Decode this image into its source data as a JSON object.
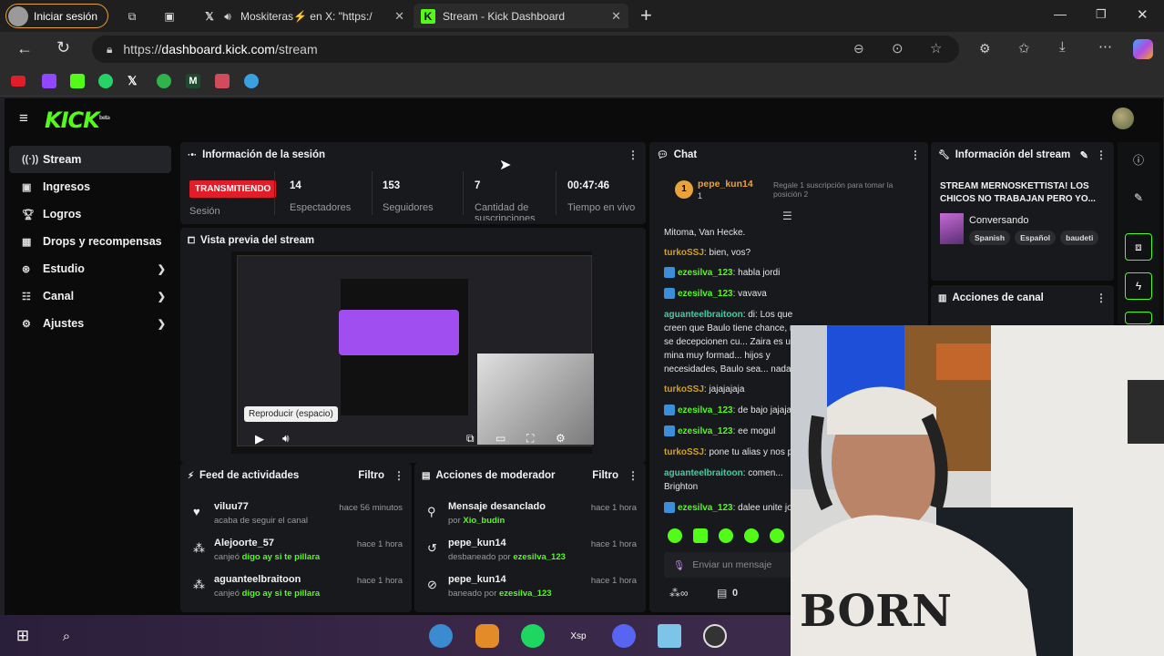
{
  "browser": {
    "signin_label": "Iniciar sesión",
    "tabs": [
      {
        "label": "Moskiteras⚡ en X: \"https:/",
        "icon": "x-icon"
      },
      {
        "label": "Stream - Kick Dashboard",
        "icon": "kick-icon"
      }
    ],
    "url_scheme": "https://",
    "url_host": "dashboard.kick.com",
    "url_path": "/stream"
  },
  "kick": {
    "logo": "KICK",
    "logo_sup": "beta",
    "sidebar": [
      {
        "label": "Stream",
        "icon": "radio-icon"
      },
      {
        "label": "Ingresos",
        "icon": "wallet-icon"
      },
      {
        "label": "Logros",
        "icon": "trophy-icon"
      },
      {
        "label": "Drops y recompensas",
        "icon": "gift-icon"
      },
      {
        "label": "Estudio",
        "icon": "studio-icon"
      },
      {
        "label": "Canal",
        "icon": "channel-icon"
      },
      {
        "label": "Ajustes",
        "icon": "gear-icon"
      }
    ],
    "session": {
      "title": "Información de la sesión",
      "live_badge": "TRANSMITIENDO",
      "live_label": "Sesión",
      "stats": [
        {
          "value": "14",
          "label": "Espectadores"
        },
        {
          "value": "153",
          "label": "Seguidores"
        },
        {
          "value": "7",
          "label": "Cantidad de suscripciones"
        },
        {
          "value": "00:47:46",
          "label": "Tiempo en vivo"
        }
      ]
    },
    "preview": {
      "title": "Vista previa del stream",
      "tooltip": "Reproducir (espacio)"
    },
    "feed": {
      "title": "Feed de actividades",
      "filter": "Filtro",
      "items": [
        {
          "user": "viluu77",
          "action": "acaba de seguir el canal",
          "highlight": "",
          "time": "hace 56 minutos",
          "icon": "heart-icon"
        },
        {
          "user": "Alejoorte_57",
          "action": "canjeó ",
          "highlight": "digo ay si te pillara",
          "time": "hace 1 hora",
          "icon": "points-icon"
        },
        {
          "user": "aguanteelbraitoon",
          "action": "canjeó ",
          "highlight": "digo ay si te pillara",
          "time": "hace 1 hora",
          "icon": "points-icon"
        }
      ]
    },
    "mod": {
      "title": "Acciones de moderador",
      "filter": "Filtro",
      "items": [
        {
          "user": "Mensaje desanclado",
          "action": "por ",
          "highlight": "Xio_budin",
          "time": "hace 1 hora",
          "icon": "unpin-icon"
        },
        {
          "user": "pepe_kun14",
          "action": "desbaneado por ",
          "highlight": "ezesilva_123",
          "time": "hace 1 hora",
          "icon": "unban-icon"
        },
        {
          "user": "pepe_kun14",
          "action": "baneado por ",
          "highlight": "ezesilva_123",
          "time": "hace 1 hora",
          "icon": "ban-icon"
        }
      ]
    },
    "chat": {
      "title": "Chat",
      "pinned_user": "pepe_kun14",
      "pinned_count": "1",
      "gift_text": "Regale 1 suscripción para tomar la posición 2",
      "messages": [
        {
          "user": "",
          "text": "Mitoma, Van Hecke.",
          "color": "#e6e6e6"
        },
        {
          "user": "turkoSSJ",
          "text": ": bien, vos?",
          "color": "#d4a017"
        },
        {
          "user": "ezesilva_123",
          "text": ": habla jordi",
          "color": "#53fc18"
        },
        {
          "user": "ezesilva_123",
          "text": ": vavava",
          "color": "#53fc18"
        },
        {
          "user": "aguanteelbraitoon",
          "text": ": di: Los que creen que Baulo tiene chance, no se decepcionen cu... Zaira es una mina muy formad... hijos y necesidades, Baulo sea... nada.",
          "color": "#3fd0a0"
        },
        {
          "user": "turkoSSJ",
          "text": ": jajajajaja",
          "color": "#d4a017"
        },
        {
          "user": "ezesilva_123",
          "text": ": de bajo jajaja",
          "color": "#53fc18"
        },
        {
          "user": "ezesilva_123",
          "text": ": ee mogul",
          "color": "#53fc18"
        },
        {
          "user": "turkoSSJ",
          "text": ": pone tu alias y nos p...",
          "color": "#d4a017"
        },
        {
          "user": "aguanteelbraitoon",
          "text": ": comen... Brighton",
          "color": "#3fd0a0"
        },
        {
          "user": "ezesilva_123",
          "text": ": dalee unite jo...",
          "color": "#53fc18"
        }
      ],
      "input_placeholder": "Enviar un mensaje",
      "footer_count": "0"
    },
    "stream_info": {
      "title": "Información del stream",
      "stream_title": "STREAM MERNOSKETTISTA! LOS CHICOS NO TRABAJAN PERO YO...",
      "category": "Conversando",
      "tags": [
        "Spanish",
        "Español",
        "baudeti"
      ]
    },
    "channel_actions": {
      "title": "Acciones de canal"
    }
  },
  "colors": {
    "kick_green": "#53fc18",
    "live_red": "#e11d2a"
  }
}
